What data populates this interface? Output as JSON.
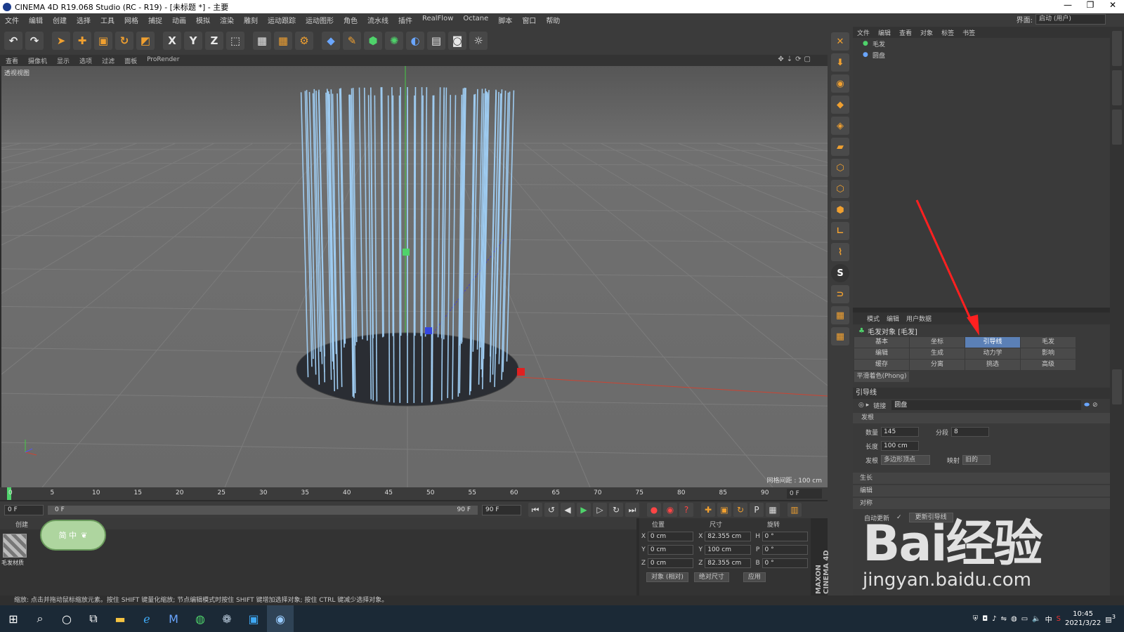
{
  "titlebar": {
    "title": "CINEMA 4D R19.068 Studio (RC - R19) - [未标题 *] - 主要",
    "min": "—",
    "max": "❐",
    "close": "✕"
  },
  "menubar": {
    "items": [
      "文件",
      "编辑",
      "创建",
      "选择",
      "工具",
      "网格",
      "捕捉",
      "动画",
      "模拟",
      "渲染",
      "雕刻",
      "运动跟踪",
      "运动图形",
      "角色",
      "流水线",
      "插件",
      "RealFlow",
      "Octane",
      "脚本",
      "窗口",
      "帮助"
    ],
    "layout_label": "界面:",
    "layout_value": "启动 (用户)"
  },
  "toolbar": {
    "icons": [
      {
        "name": "undo-icon",
        "glyph": "↶",
        "cls": "white"
      },
      {
        "name": "redo-icon",
        "glyph": "↷",
        "cls": "white"
      },
      {
        "name": "select-arrow-icon",
        "glyph": "➤",
        "cls": "orange"
      },
      {
        "name": "move-icon",
        "glyph": "✚",
        "cls": "orange"
      },
      {
        "name": "scale-icon",
        "glyph": "▣",
        "cls": "orange"
      },
      {
        "name": "rotate-icon",
        "glyph": "↻",
        "cls": "orange"
      },
      {
        "name": "recent-tool-icon",
        "glyph": "◩",
        "cls": "orange"
      },
      {
        "name": "x-axis-icon",
        "glyph": "X",
        "cls": "white"
      },
      {
        "name": "y-axis-icon",
        "glyph": "Y",
        "cls": "white"
      },
      {
        "name": "z-axis-icon",
        "glyph": "Z",
        "cls": "white"
      },
      {
        "name": "coordinate-system-icon",
        "glyph": "⬚",
        "cls": "white"
      },
      {
        "name": "render-view-icon",
        "glyph": "▦",
        "cls": "white"
      },
      {
        "name": "render-picture-viewer-icon",
        "glyph": "▦",
        "cls": "orange"
      },
      {
        "name": "render-settings-icon",
        "glyph": "⚙",
        "cls": "orange"
      },
      {
        "name": "cube-primitive-icon",
        "glyph": "◆",
        "cls": "blue"
      },
      {
        "name": "pen-spline-icon",
        "glyph": "✎",
        "cls": "orange"
      },
      {
        "name": "subdivision-icon",
        "glyph": "⬢",
        "cls": "green"
      },
      {
        "name": "cloner-icon",
        "glyph": "✺",
        "cls": "green"
      },
      {
        "name": "deformer-icon",
        "glyph": "◐",
        "cls": "blue"
      },
      {
        "name": "floor-icon",
        "glyph": "▤",
        "cls": "white"
      },
      {
        "name": "camera-icon",
        "glyph": "◙",
        "cls": "white"
      },
      {
        "name": "light-icon",
        "glyph": "☼",
        "cls": "white"
      }
    ]
  },
  "viewmenu": {
    "items": [
      "查看",
      "摄像机",
      "显示",
      "选项",
      "过滤",
      "面板",
      "ProRender"
    ],
    "icons": "✥⇣⟳▢"
  },
  "viewport": {
    "label": "透视视图",
    "grid_spacing": "网格间距 : 100 cm"
  },
  "rightstrip": {
    "icons": [
      {
        "name": "render-region-icon",
        "glyph": "✕"
      },
      {
        "name": "download-icon",
        "glyph": "⬇"
      },
      {
        "name": "globe-icon",
        "glyph": "◉"
      },
      {
        "name": "model-mode-icon",
        "glyph": "◆"
      },
      {
        "name": "texture-mode-icon",
        "glyph": "◈"
      },
      {
        "name": "workplane-icon",
        "glyph": "▰"
      },
      {
        "name": "points-mode-icon",
        "glyph": "⬡"
      },
      {
        "name": "edges-mode-icon",
        "glyph": "⬡"
      },
      {
        "name": "polygons-mode-icon",
        "glyph": "⬢"
      },
      {
        "name": "axis-mode-icon",
        "glyph": "∟"
      },
      {
        "name": "tweak-icon",
        "glyph": "⌇"
      },
      {
        "name": "snap-s-icon",
        "glyph": "S",
        "s": true
      },
      {
        "name": "magnet-icon",
        "glyph": "⊃"
      },
      {
        "name": "grid-snap-icon",
        "glyph": "▦"
      },
      {
        "name": "workplane-lock-icon",
        "glyph": "▦"
      }
    ]
  },
  "objmgr": {
    "menu": [
      "文件",
      "编辑",
      "查看",
      "对象",
      "标签",
      "书签"
    ],
    "objects": [
      {
        "name": "毛发",
        "color": "#4fd36b"
      },
      {
        "name": "圆盘",
        "color": "#6aa6ff"
      }
    ]
  },
  "attrmgr": {
    "menu": [
      "模式",
      "编辑",
      "用户数据"
    ],
    "object_title": "毛发对象 [毛发]",
    "tabs": [
      "基本",
      "坐标",
      "引导线",
      "毛发",
      "编辑",
      "生成",
      "动力学",
      "影响",
      "缓存",
      "分离",
      "挑选",
      "高级"
    ],
    "active_tab": "引导线",
    "phong": "平滑着色(Phong)",
    "section": "引导线",
    "link_label": "链接",
    "link_value": "圆盘",
    "group_growth": "发根",
    "count_label": "数量",
    "count_value": "145",
    "segments_label": "分段",
    "segments_value": "8",
    "length_label": "长度",
    "length_value": "100 cm",
    "root_label": "发根",
    "root_value": "多边形顶点",
    "mapping_label": "映射",
    "mapping_value": "旧的",
    "collapsed": [
      "生长",
      "编辑",
      "对称"
    ],
    "auto_update_label": "自动更新",
    "auto_update_check": "✓",
    "update_button": "更新引导线"
  },
  "timeline": {
    "ticks": [
      "0",
      "5",
      "10",
      "15",
      "20",
      "25",
      "30",
      "35",
      "40",
      "45",
      "50",
      "55",
      "60",
      "65",
      "70",
      "75",
      "80",
      "85",
      "90"
    ],
    "end_field": "0 F"
  },
  "transport": {
    "start": "0 F",
    "slider_start": "0 F",
    "slider_end": "90 F",
    "end": "90 F"
  },
  "matmgr": {
    "menu": [
      "创建"
    ],
    "material_name": "毛发材质"
  },
  "ime": {
    "text": "简 中"
  },
  "coord": {
    "headers": [
      "位置",
      "尺寸",
      "旋转"
    ],
    "rows": [
      {
        "p": "X",
        "pv": "0 cm",
        "s": "X",
        "sv": "82.355 cm",
        "r": "H",
        "rv": "0 °"
      },
      {
        "p": "Y",
        "pv": "0 cm",
        "s": "Y",
        "sv": "100 cm",
        "r": "P",
        "rv": "0 °"
      },
      {
        "p": "Z",
        "pv": "0 cm",
        "s": "Z",
        "sv": "82.355 cm",
        "r": "B",
        "rv": "0 °"
      }
    ],
    "mode1": "对象 (相对)",
    "mode2": "绝对尺寸",
    "apply": "应用"
  },
  "maxon": "MAXON CINEMA 4D",
  "status": "缩放: 点击并拖动鼠标缩放元素。按住 SHIFT 键量化缩放; 节点编辑模式时按住 SHIFT 键增加选择对象; 按住 CTRL 键减少选择对象。",
  "taskbar": {
    "time": "10:45",
    "date": "2021/3/22",
    "ime": "中",
    "notif": "3"
  },
  "watermark": {
    "brand": "Bai经验",
    "site": "jingyan.baidu.com"
  },
  "colors": {
    "accent": "#5b80b6",
    "hair": "#9ecbf0",
    "disc": "#2a2d33"
  }
}
